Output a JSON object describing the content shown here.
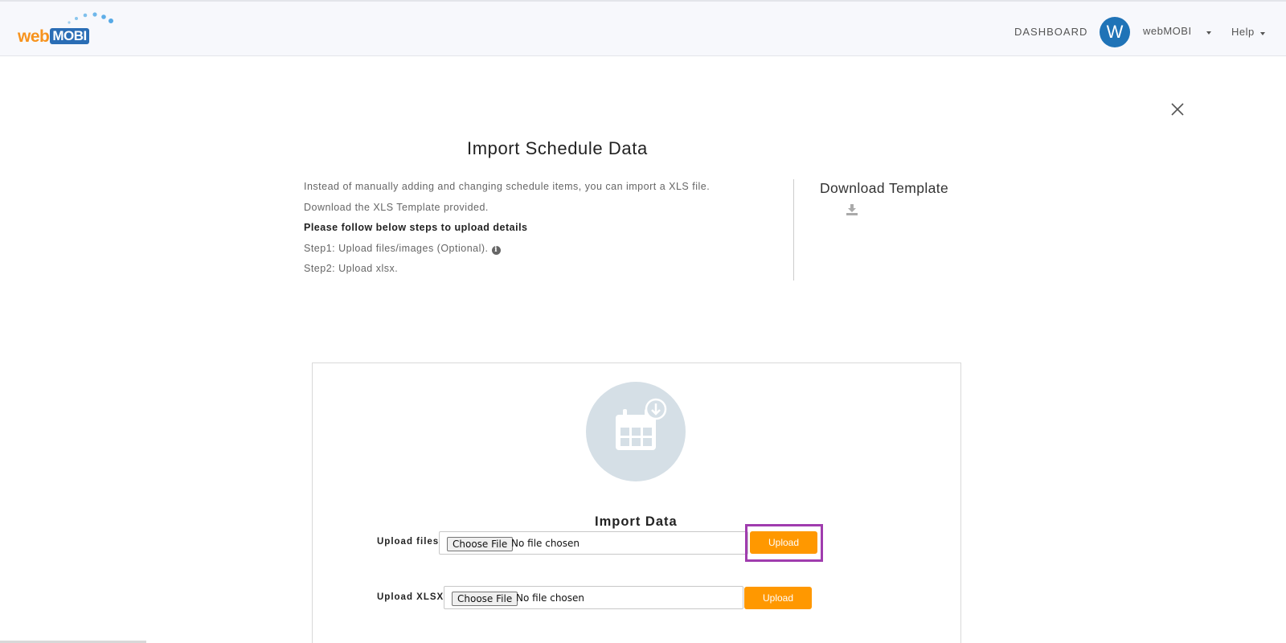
{
  "header": {
    "logo": {
      "text_web": "web",
      "text_mobi": "MOBI",
      "brand_orange": "#f7931e",
      "brand_blue": "#2a6db5"
    },
    "nav_dashboard": "DASHBOARD",
    "avatar_letter": "W",
    "avatar_color": "#1f73b7",
    "username": "webMOBI",
    "help": "Help"
  },
  "page": {
    "title": "Import Schedule Data",
    "instructions": [
      "Instead of manually adding and changing schedule items, you can import a XLS file.",
      "Download the XLS Template provided.",
      "Please follow below steps to upload details",
      "Step1: Upload files/images (Optional).",
      "Step2: Upload xlsx."
    ],
    "download_template": "Download Template"
  },
  "import": {
    "title": "Import Data",
    "rows": [
      {
        "label": "Upload files",
        "choose_label": "Choose File",
        "file_status": "No file chosen",
        "upload_label": "Upload"
      },
      {
        "label": "Upload XLSX",
        "choose_label": "Choose File",
        "file_status": "No file chosen",
        "upload_label": "Upload"
      }
    ],
    "accent_color": "#ff9800",
    "highlight_color": "#a03cae"
  }
}
